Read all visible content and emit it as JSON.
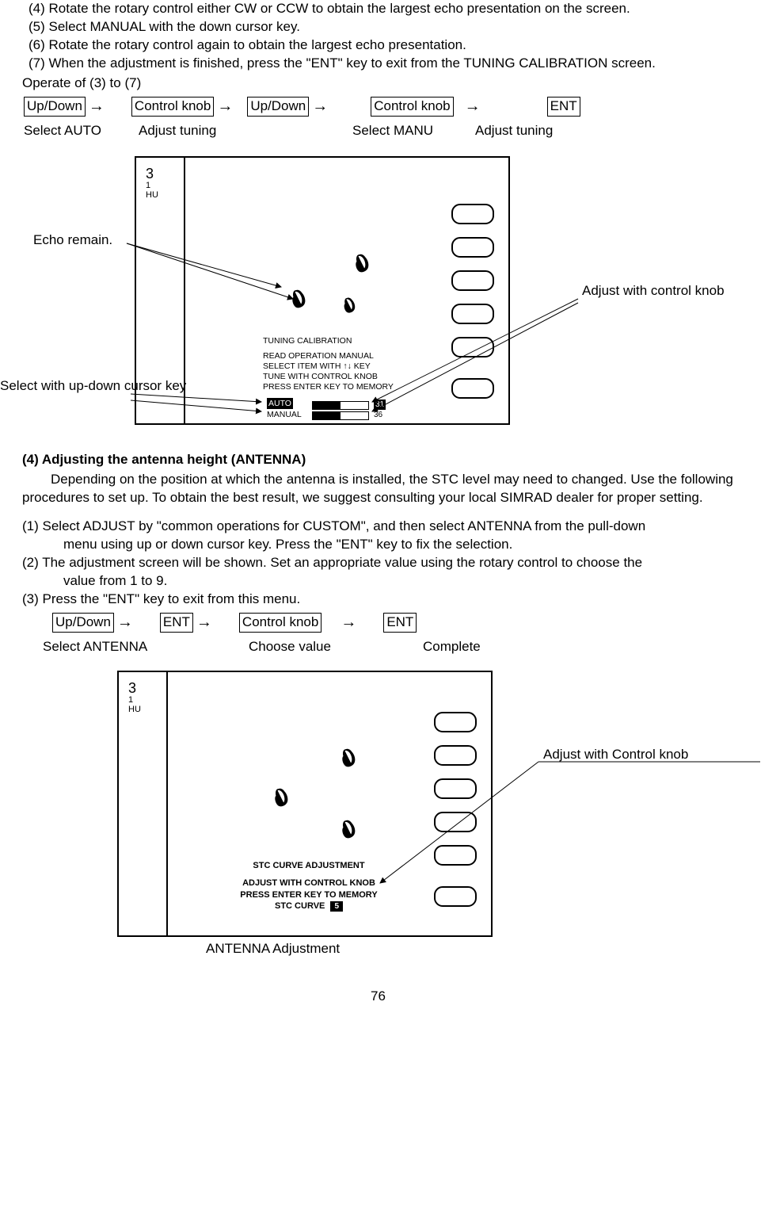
{
  "steps": {
    "s4": "(4)  Rotate the rotary control either CW or CCW to obtain the largest echo presentation on the screen.",
    "s5": "(5)  Select MANUAL with the down cursor key.",
    "s6": "(6)    Rotate the rotary control again to obtain the largest echo presentation.",
    "s7": "(7)  When the adjustment is finished, press the \"ENT\" key to exit from the TUNING CALIBRATION screen."
  },
  "operate_heading": "Operate of (3) to (7)",
  "operate1": {
    "boxes": [
      "Up/Down",
      "Control knob",
      "Up/Down",
      "Control knob",
      "ENT"
    ],
    "arrow": "→",
    "labels": [
      "Select AUTO",
      "Adjust tuning",
      "Select MANU",
      "Adjust tuning"
    ]
  },
  "diagram1": {
    "range_big": "3",
    "range_sm1": "1",
    "range_sm2": "HU",
    "tuning_lines": [
      "TUNING CALIBRATION",
      "READ OPERATION MANUAL",
      "SELECT ITEM WITH  ↑↓  KEY",
      "TUNE WITH CONTROL KNOB",
      "PRESS ENTER KEY TO MEMORY"
    ],
    "auto_label": "AUTO",
    "manual_label": "MANUAL",
    "val_auto": "31",
    "val_manual": "36",
    "ann_echo": "Echo remain.",
    "ann_select": "Select with up-down cursor key",
    "ann_adjust": "Adjust with control knob"
  },
  "section4": {
    "heading": "(4) Adjusting the antenna height (ANTENNA)",
    "para": "Depending on the position at which the antenna is installed, the STC level may need to changed. Use the following procedures to set up. To obtain the best result, we suggest consulting your local SIMRAD dealer for proper setting.",
    "n1a": "(1)  Select ADJUST by \"common operations for CUSTOM\", and then select ANTENNA from the pull-down",
    "n1b": "menu using up or down cursor key. Press the \"ENT\" key to fix the selection.",
    "n2a": "(2)  The adjustment screen will be shown. Set an appropriate value using the rotary control to choose the",
    "n2b": "value from 1 to 9.",
    "n3": "(3)  Press the \"ENT\" key to exit from this menu."
  },
  "operate2": {
    "boxes": [
      "Up/Down",
      "ENT",
      "Control knob",
      "ENT"
    ],
    "arrow": "→",
    "labels": [
      "Select ANTENNA",
      "Choose value",
      "Complete"
    ]
  },
  "diagram2": {
    "range_big": "3",
    "range_sm1": "1",
    "range_sm2": "HU",
    "stc_lines": [
      "STC CURVE ADJUSTMENT",
      "ADJUST WITH CONTROL KNOB",
      "PRESS ENTER KEY TO MEMORY"
    ],
    "stc_curve_label": "STC CURVE",
    "stc_value": "5",
    "ann_adjust": "Adjust with Control knob",
    "caption": "ANTENNA Adjustment"
  },
  "page_number": "76"
}
